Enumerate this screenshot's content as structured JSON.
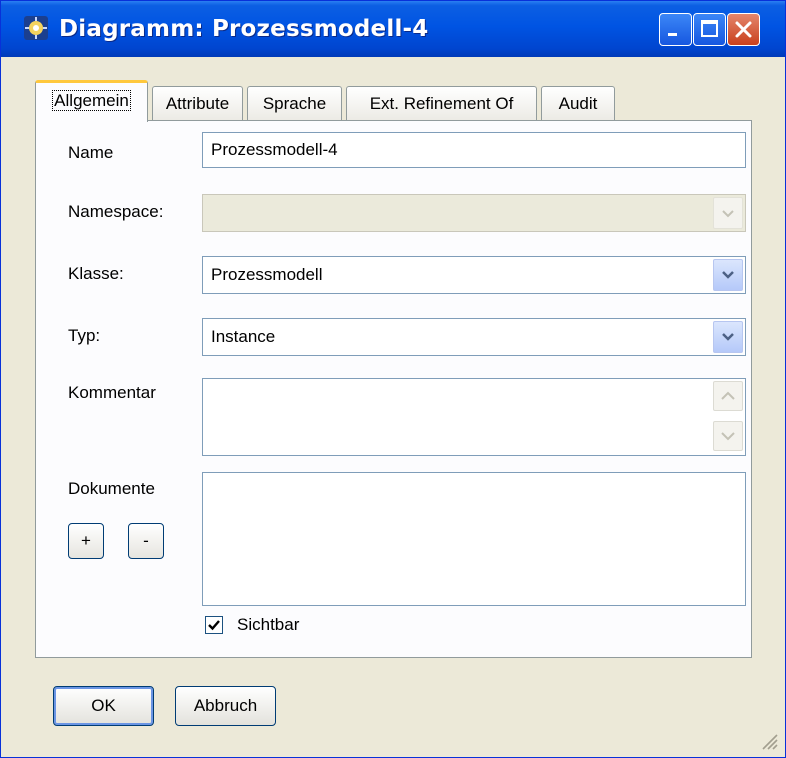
{
  "window": {
    "title": "Diagramm: Prozessmodell-4",
    "icons": {
      "app": "diagram-app-icon",
      "minimize": "minimize-icon",
      "maximize": "maximize-icon",
      "close": "close-icon"
    }
  },
  "tabs": [
    {
      "label": "Allgemein",
      "active": true
    },
    {
      "label": "Attribute",
      "active": false
    },
    {
      "label": "Sprache",
      "active": false
    },
    {
      "label": "Ext. Refinement Of",
      "active": false
    },
    {
      "label": "Audit",
      "active": false
    }
  ],
  "form": {
    "name_label": "Name",
    "name_value": "Prozessmodell-4",
    "namespace_label": "Namespace:",
    "namespace_value": "",
    "klasse_label": "Klasse:",
    "klasse_value": "Prozessmodell",
    "typ_label": "Typ:",
    "typ_value": "Instance",
    "kommentar_label": "Kommentar",
    "kommentar_value": "",
    "dokumente_label": "Dokumente",
    "add_doc_label": "+",
    "remove_doc_label": "-",
    "sichtbar_label": "Sichtbar",
    "sichtbar_checked": true
  },
  "footer": {
    "ok_label": "OK",
    "cancel_label": "Abbruch"
  },
  "colors": {
    "titlebar": "#0054e3",
    "close_button": "#c9401d",
    "active_tab_highlight": "#ffc83c",
    "window_bg": "#ece9d8"
  }
}
